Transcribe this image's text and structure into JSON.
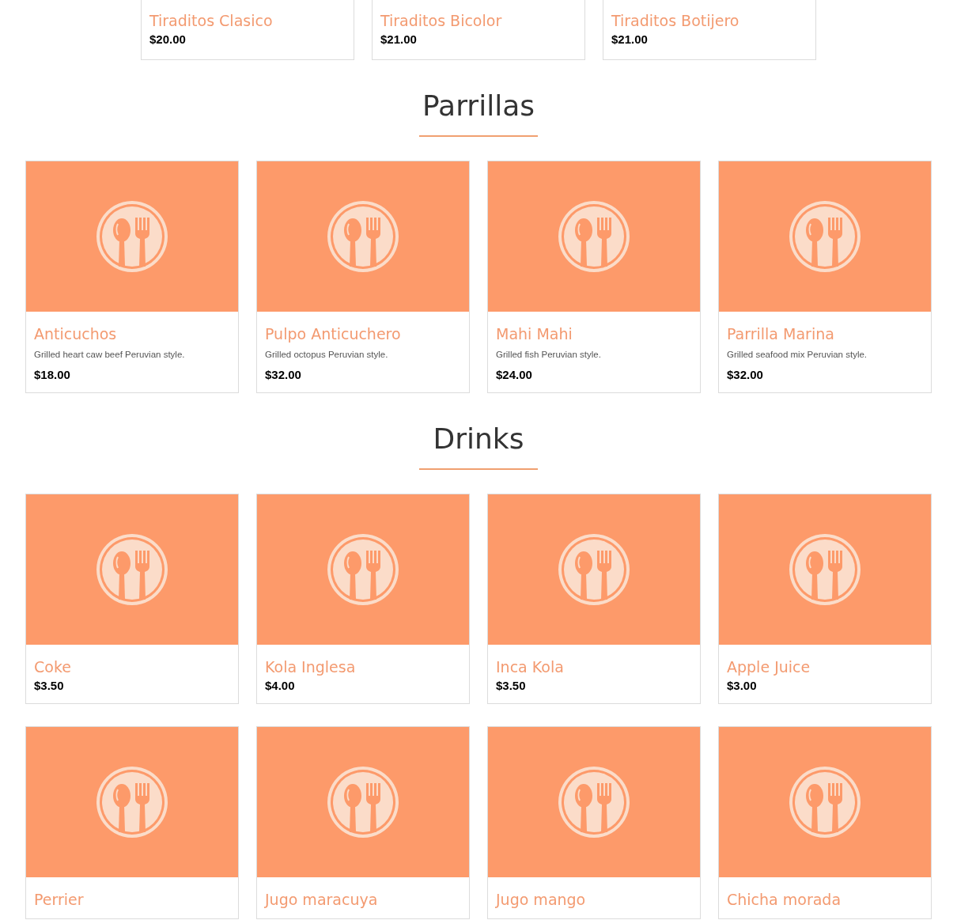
{
  "previous_section": {
    "items": [
      {
        "name": "Tiraditos Clasico",
        "price": "$20.00"
      },
      {
        "name": "Tiraditos Bicolor",
        "price": "$21.00"
      },
      {
        "name": "Tiraditos Botijero",
        "price": "$21.00"
      }
    ]
  },
  "sections": [
    {
      "title": "Parrillas",
      "items": [
        {
          "name": "Anticuchos",
          "description": "Grilled heart caw beef Peruvian style.",
          "price": "$18.00"
        },
        {
          "name": "Pulpo Anticuchero",
          "description": "Grilled octopus Peruvian style.",
          "price": "$32.00"
        },
        {
          "name": "Mahi Mahi",
          "description": "Grilled fish Peruvian style.",
          "price": "$24.00"
        },
        {
          "name": "Parrilla Marina",
          "description": "Grilled seafood mix Peruvian style.",
          "price": "$32.00"
        }
      ]
    },
    {
      "title": "Drinks",
      "items": [
        {
          "name": "Coke",
          "price": "$3.50"
        },
        {
          "name": "Kola Inglesa",
          "price": "$4.00"
        },
        {
          "name": "Inca Kola",
          "price": "$3.50"
        },
        {
          "name": "Apple Juice",
          "price": "$3.00"
        },
        {
          "name": "Perrier"
        },
        {
          "name": "Jugo maracuya"
        },
        {
          "name": "Jugo mango"
        },
        {
          "name": "Chicha morada"
        }
      ]
    }
  ]
}
